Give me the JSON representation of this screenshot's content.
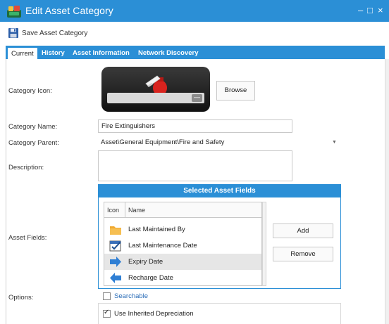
{
  "window": {
    "title": "Edit Asset Category",
    "minimize": "–",
    "maximize": "□",
    "close": "×"
  },
  "toolbar": {
    "save_label": "Save Asset Category"
  },
  "tabs": [
    {
      "label": "Current",
      "active": true
    },
    {
      "label": "History",
      "active": false
    },
    {
      "label": "Asset Information",
      "active": false
    },
    {
      "label": "Network Discovery",
      "active": false
    }
  ],
  "form": {
    "category_icon_label": "Category Icon:",
    "browse_label": "Browse",
    "category_name_label": "Category Name:",
    "category_name_value": "Fire Extinguishers",
    "category_parent_label": "Category Parent:",
    "category_parent_value": "Asset\\General Equipment\\Fire and Safety",
    "description_label": "Description:",
    "description_value": "",
    "asset_fields_label": "Asset Fields:",
    "options_label": "Options:"
  },
  "asset_fields": {
    "header": "Selected Asset Fields",
    "col_icon": "Icon",
    "col_name": "Name",
    "rows": [
      {
        "name": "Last Maintained By",
        "icon": "folder-icon",
        "selected": false
      },
      {
        "name": "Last Maintenance Date",
        "icon": "calendar-check-icon",
        "selected": false
      },
      {
        "name": "Expiry Date",
        "icon": "arrow-right-icon",
        "selected": true
      },
      {
        "name": "Recharge Date",
        "icon": "arrow-left-icon",
        "selected": false
      }
    ],
    "add_label": "Add",
    "remove_label": "Remove"
  },
  "options": [
    {
      "label": "Searchable",
      "checked": false
    },
    {
      "label": "Use Inherited Depreciation",
      "checked": true
    }
  ],
  "colors": {
    "accent": "#2b8fd6",
    "selected_row": "#e6e6e6"
  }
}
